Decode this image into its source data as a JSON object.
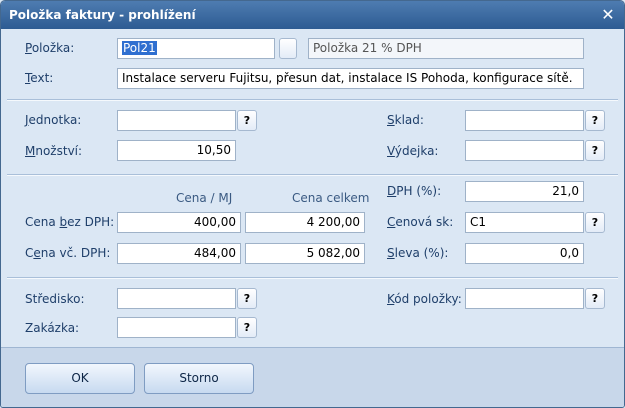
{
  "window": {
    "title": "Položka faktury - prohlížení",
    "close_glyph": "✕"
  },
  "polozka": {
    "label_u": "P",
    "label_rest": "oložka:",
    "code": "Pol21",
    "button_glyph": "",
    "description": "Položka 21 % DPH"
  },
  "text": {
    "label_u": "T",
    "label_rest": "ext:",
    "value": "Instalace serveru Fujitsu, přesun dat, instalace IS Pohoda, konfigurace sítě."
  },
  "jednotka": {
    "label_u": "J",
    "label_rest": "ednotka:",
    "value": ""
  },
  "mnozstvi": {
    "label_u": "M",
    "label_rest": "nožství:",
    "value": "10,50"
  },
  "sklad": {
    "label_u": "S",
    "label_rest": "klad:",
    "value": ""
  },
  "vydejka": {
    "label_u": "V",
    "label_rest": "ýdejka:",
    "value": ""
  },
  "prices": {
    "header_unit": "Cena / MJ",
    "header_total": "Cena celkem",
    "bez_dph": {
      "label_pre": "Cena ",
      "label_u": "b",
      "label_rest": "ez DPH:",
      "unit": "400,00",
      "total": "4 200,00"
    },
    "vc_dph": {
      "label_pre": "C",
      "label_u": "e",
      "label_rest": "na vč. DPH:",
      "unit": "484,00",
      "total": "5 082,00"
    }
  },
  "dph": {
    "label_u": "D",
    "label_rest": "PH (%):",
    "value": "21,0"
  },
  "cenova_sk": {
    "label_u": "C",
    "label_rest": "enová sk:",
    "value": "C1"
  },
  "sleva": {
    "label_u": "S",
    "label_rest": "leva (%):",
    "value": "0,0"
  },
  "stredisko": {
    "label": "Středisko:",
    "value": ""
  },
  "zakazka": {
    "label": "Zakázka:",
    "value": ""
  },
  "kod_polozky": {
    "label_u": "K",
    "label_rest": "ód položky:",
    "value": ""
  },
  "lookup_glyph": "?",
  "buttons": {
    "ok": "OK",
    "storno": "Storno"
  }
}
